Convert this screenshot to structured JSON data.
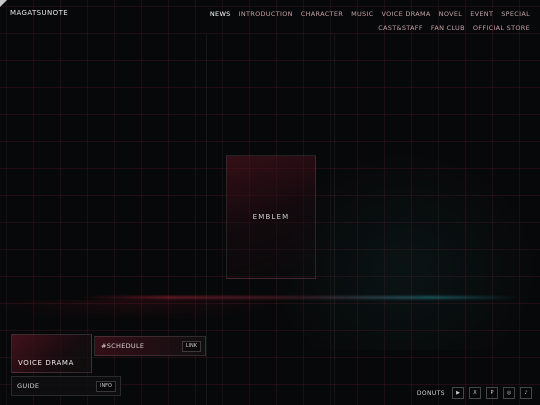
{
  "header": {
    "logo": "MAGATSUNOTE",
    "nav": [
      {
        "label": "NEWS",
        "active": true
      },
      {
        "label": "INTRODUCTION"
      },
      {
        "label": "CHARACTER"
      },
      {
        "label": "MUSIC"
      },
      {
        "label": "VOICE DRAMA"
      },
      {
        "label": "NOVEL"
      },
      {
        "label": "EVENT"
      },
      {
        "label": "SPECIAL"
      },
      {
        "label": "CAST&STAFF"
      },
      {
        "label": "FAN CLUB"
      },
      {
        "label": "OFFICIAL STORE"
      }
    ]
  },
  "hero": {
    "emblem": "EMBLEM"
  },
  "cards": {
    "voice_drama": "VOICE DRAMA",
    "schedule": {
      "label": "#SCHEDULE",
      "button": "LINK"
    },
    "guide": {
      "label": "GUIDE",
      "button": "INFO"
    }
  },
  "footer": {
    "donuts_label": "DONUTS",
    "socials": [
      {
        "icon": "youtube-icon",
        "glyph": "▶"
      },
      {
        "icon": "x-icon",
        "glyph": "X"
      },
      {
        "icon": "pixiv-icon",
        "glyph": "P"
      },
      {
        "icon": "instagram-icon",
        "glyph": "◎"
      },
      {
        "icon": "tiktok-icon",
        "glyph": "♪"
      }
    ]
  }
}
